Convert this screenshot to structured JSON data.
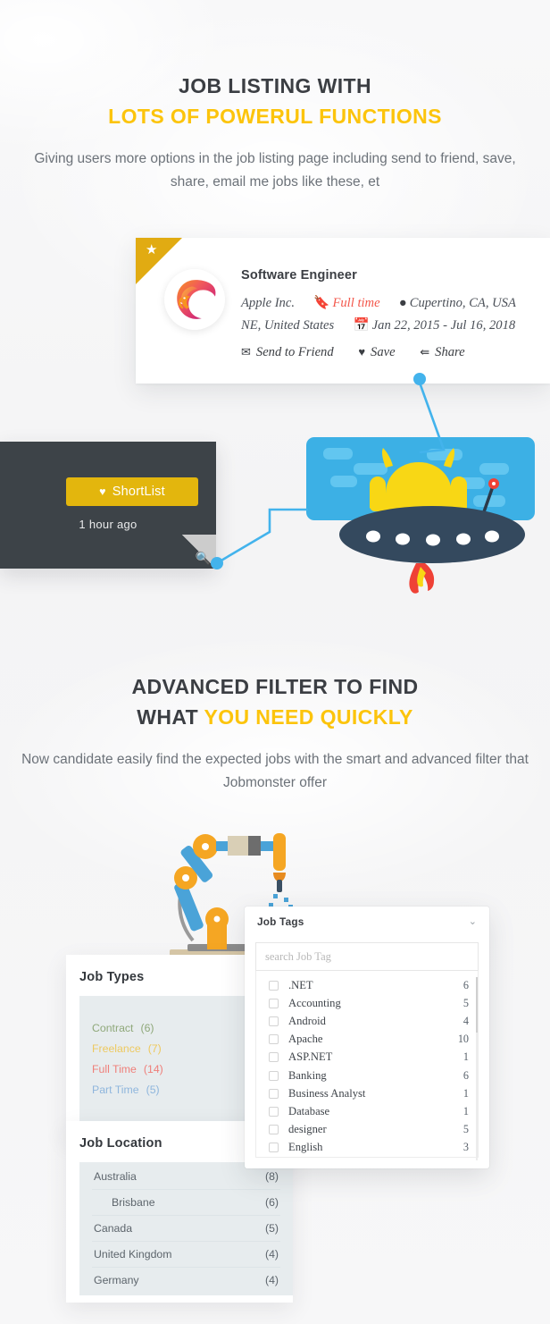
{
  "hero1": {
    "title_line1": "JOB LISTING WITH",
    "title_line2": "LOTS OF POWERUL FUNCTIONS",
    "subtitle": "Giving users more options in the job listing page including send to friend, save, share, email me jobs like these, et"
  },
  "hero2": {
    "title_line1": "ADVANCED FILTER TO FIND",
    "title_line2_plain": "WHAT ",
    "title_line2_accent": "YOU NEED QUICKLY",
    "subtitle": "Now candidate easily find the expected jobs with the smart and advanced filter that Jobmonster offer"
  },
  "job_card": {
    "featured_star": "★",
    "title": "Software Engineer",
    "company": "Apple Inc.",
    "job_type": "Full time",
    "job_type_icon": "bookmark-icon",
    "location_icon": "map-pin-icon",
    "location_line1": "Cupertino, CA, USA",
    "location_line2": "NE, United States",
    "date_icon": "calendar-icon",
    "date_range": "Jan 22, 2015 - Jul 16, 2018",
    "actions": [
      {
        "label": "Send to Friend",
        "icon": "envelope-icon",
        "glyph": "✉"
      },
      {
        "label": "Save",
        "icon": "heart-icon",
        "glyph": "♥"
      },
      {
        "label": "Share",
        "icon": "share-icon",
        "glyph": "⋖"
      }
    ]
  },
  "shortlist_panel": {
    "button_label": "ShortList",
    "button_icon": "heart-icon",
    "time_ago": "1 hour ago",
    "zoom_icon": "magnifier-plus-icon"
  },
  "job_types": {
    "heading": "Job Types",
    "items": [
      {
        "label": "Contract",
        "count": "(6)",
        "color": "#8fa87a"
      },
      {
        "label": "Freelance",
        "count": "(7)",
        "color": "#eec95f"
      },
      {
        "label": "Full Time",
        "count": "(14)",
        "color": "#ef7f7a"
      },
      {
        "label": "Part Time",
        "count": "(5)",
        "color": "#8fb6dd"
      }
    ]
  },
  "job_location": {
    "heading": "Job Location",
    "items": [
      {
        "label": "Australia",
        "count": "(8)",
        "sub": false
      },
      {
        "label": "Brisbane",
        "count": "(6)",
        "sub": true
      },
      {
        "label": "Canada",
        "count": "(5)",
        "sub": false
      },
      {
        "label": "United Kingdom",
        "count": "(4)",
        "sub": false
      },
      {
        "label": "Germany",
        "count": "(4)",
        "sub": false
      }
    ]
  },
  "job_tags": {
    "heading": "Job Tags",
    "chevron_icon": "chevron-down-icon",
    "chevron_glyph": "⌄",
    "search_placeholder": "search Job Tag",
    "tags": [
      {
        "label": ".NET",
        "count": "6"
      },
      {
        "label": "Accounting",
        "count": "5"
      },
      {
        "label": "Android",
        "count": "4"
      },
      {
        "label": "Apache",
        "count": "10"
      },
      {
        "label": "ASP.NET",
        "count": "1"
      },
      {
        "label": "Banking",
        "count": "6"
      },
      {
        "label": "Business Analyst",
        "count": "1"
      },
      {
        "label": "Database",
        "count": "1"
      },
      {
        "label": "designer",
        "count": "5"
      },
      {
        "label": "English",
        "count": "3"
      }
    ]
  },
  "colors": {
    "accent_yellow": "#fcc40c",
    "button_gold": "#e3b60d",
    "ribbon_gold": "#e1ab12",
    "dark_panel": "#3d4348",
    "connector_blue": "#43b3ec",
    "alien_box_blue": "#3cb0e5",
    "alien_yellow": "#f8d715",
    "ufo_navy": "#34495e",
    "flame_red": "#ef4136",
    "heading_dark": "#3b3e43",
    "body_gray": "#6c7279"
  },
  "illustrations": {
    "alien": "alien-ufo-illustration",
    "robot": "robot-arm-illustration",
    "lion_logo": "lion-logo-icon"
  }
}
